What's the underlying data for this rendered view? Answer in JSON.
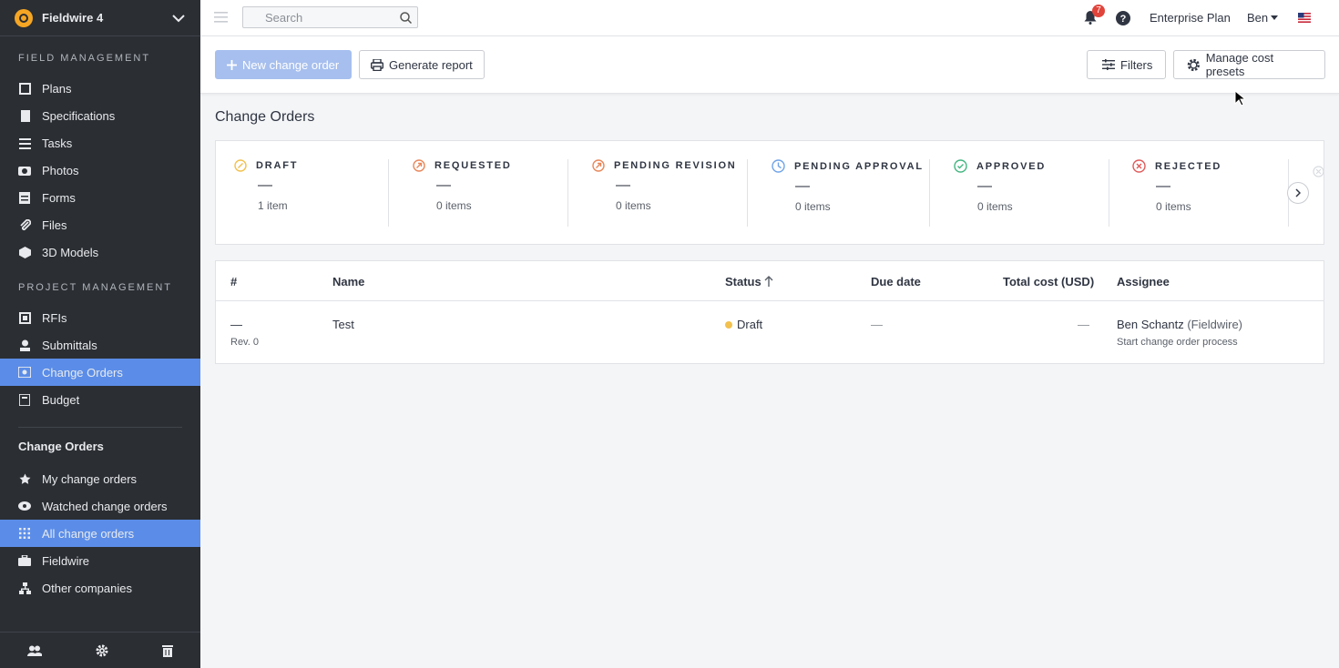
{
  "project": {
    "name": "Fieldwire 4"
  },
  "sidebar": {
    "section_field": "FIELD MANAGEMENT",
    "field_items": [
      {
        "label": "Plans"
      },
      {
        "label": "Specifications"
      },
      {
        "label": "Tasks"
      },
      {
        "label": "Photos"
      },
      {
        "label": "Forms"
      },
      {
        "label": "Files"
      },
      {
        "label": "3D Models"
      }
    ],
    "section_project": "PROJECT MANAGEMENT",
    "project_items": [
      {
        "label": "RFIs"
      },
      {
        "label": "Submittals"
      },
      {
        "label": "Change Orders"
      },
      {
        "label": "Budget"
      }
    ],
    "sub_title": "Change Orders",
    "sub_items": [
      {
        "label": "My change orders"
      },
      {
        "label": "Watched change orders"
      },
      {
        "label": "All change orders"
      },
      {
        "label": "Fieldwire"
      },
      {
        "label": "Other companies"
      }
    ]
  },
  "topbar": {
    "search_placeholder": "Search",
    "notif_count": "7",
    "plan": "Enterprise Plan",
    "user": "Ben"
  },
  "toolbar": {
    "new_label": "New change order",
    "report_label": "Generate report",
    "filters_label": "Filters",
    "presets_label": "Manage cost presets"
  },
  "page_title": "Change Orders",
  "summary": [
    {
      "label": "DRAFT",
      "value": "—",
      "count": "1 item",
      "color": "#f2c14e"
    },
    {
      "label": "REQUESTED",
      "value": "—",
      "count": "0 items",
      "color": "#e8875a"
    },
    {
      "label": "PENDING REVISION",
      "value": "—",
      "count": "0 items",
      "color": "#e8875a"
    },
    {
      "label": "PENDING APPROVAL",
      "value": "—",
      "count": "0 items",
      "color": "#6fa3e8"
    },
    {
      "label": "APPROVED",
      "value": "—",
      "count": "0 items",
      "color": "#43b581"
    },
    {
      "label": "REJECTED",
      "value": "—",
      "count": "0 items",
      "color": "#e05a5a"
    }
  ],
  "table": {
    "headers": {
      "num": "#",
      "name": "Name",
      "status": "Status",
      "due": "Due date",
      "cost": "Total cost (USD)",
      "assignee": "Assignee"
    },
    "rows": [
      {
        "num": "—",
        "rev": "Rev. 0",
        "name": "Test",
        "status": "Draft",
        "status_color": "#f2c14e",
        "due": "—",
        "cost": "—",
        "assignee": "Ben Schantz",
        "company": "(Fieldwire)",
        "note": "Start change order process"
      }
    ]
  }
}
